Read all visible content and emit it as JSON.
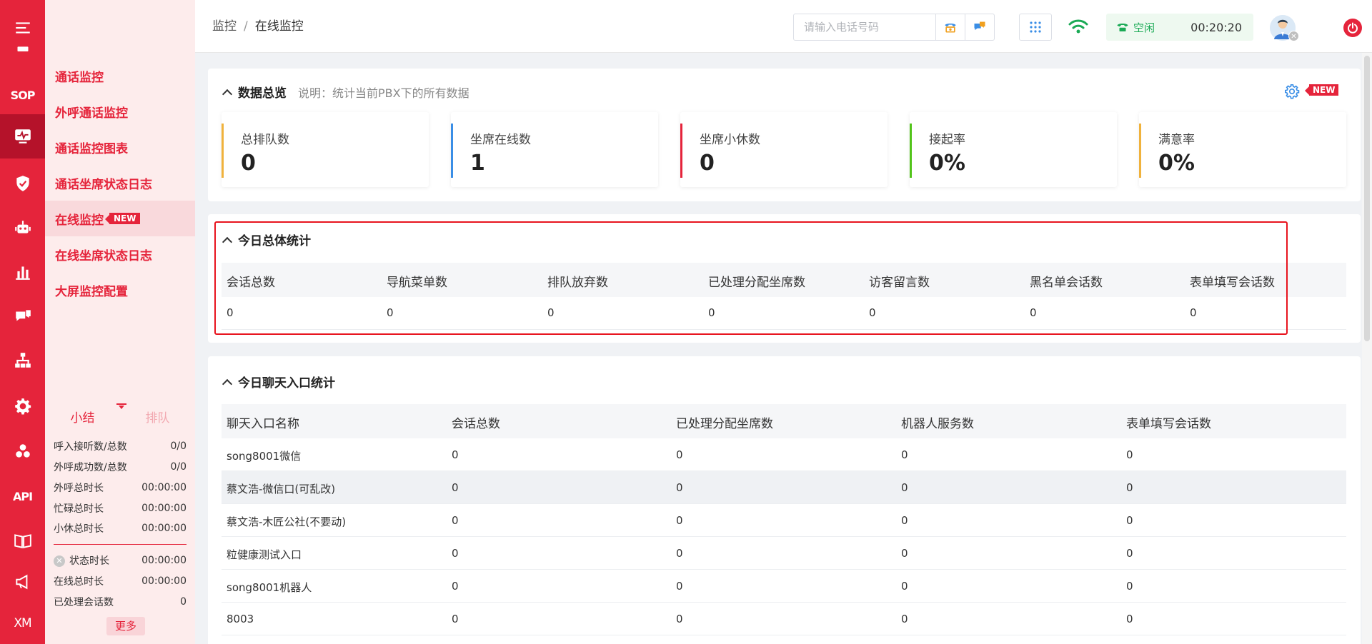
{
  "rail": {
    "items": [
      {
        "name": "menu-icon"
      },
      {
        "name": "card-icon"
      },
      {
        "name": "sop-icon",
        "text": "SOP"
      },
      {
        "name": "monitor-icon",
        "active": true
      },
      {
        "name": "shield-icon"
      },
      {
        "name": "robot-icon"
      },
      {
        "name": "chart-icon"
      },
      {
        "name": "chat-icon"
      },
      {
        "name": "org-icon"
      },
      {
        "name": "gear-icon"
      },
      {
        "name": "modules-icon"
      },
      {
        "name": "api-icon",
        "text": "API"
      },
      {
        "name": "book-icon"
      },
      {
        "name": "megaphone-icon"
      },
      {
        "name": "xm-icon",
        "text": "XM"
      }
    ]
  },
  "submenu": {
    "items": [
      {
        "label": "通话监控"
      },
      {
        "label": "外呼通话监控"
      },
      {
        "label": "通话监控图表"
      },
      {
        "label": "通话坐席状态日志"
      },
      {
        "label": "在线监控",
        "badge": "NEW",
        "active": true
      },
      {
        "label": "在线坐席状态日志"
      },
      {
        "label": "大屏监控配置"
      }
    ]
  },
  "side_stats": {
    "tabs": {
      "summary": "小结",
      "queue": "排队"
    },
    "rows": [
      {
        "label": "呼入接听数/总数",
        "value": "0/0"
      },
      {
        "label": "外呼成功数/总数",
        "value": "0/0"
      },
      {
        "label": "外呼总时长",
        "value": "00:00:00"
      },
      {
        "label": "忙碌总时长",
        "value": "00:00:00"
      },
      {
        "label": "小休总时长",
        "value": "00:00:00"
      }
    ],
    "rows2": [
      {
        "label": "状态时长",
        "value": "00:00:00"
      },
      {
        "label": "在线总时长",
        "value": "00:00:00"
      },
      {
        "label": "已处理会话数",
        "value": "0"
      }
    ],
    "more": "更多"
  },
  "header": {
    "breadcrumb": {
      "parent": "监控",
      "sep": "/",
      "current": "在线监控"
    },
    "phone_placeholder": "请输入电话号码",
    "status": {
      "label": "空闲",
      "timer": "00:20:20"
    }
  },
  "overview": {
    "title": "数据总览",
    "desc": "说明：统计当前PBX下的所有数据",
    "new_tag": "NEW",
    "kpis": [
      {
        "label": "总排队数",
        "value": "0",
        "color": "#f0b23c"
      },
      {
        "label": "坐席在线数",
        "value": "1",
        "color": "#3a8ee6"
      },
      {
        "label": "坐席小休数",
        "value": "0",
        "color": "#e5243b"
      },
      {
        "label": "接起率",
        "value": "0%",
        "color": "#52c41a"
      },
      {
        "label": "满意率",
        "value": "0%",
        "color": "#f0b23c"
      }
    ]
  },
  "today_total": {
    "title": "今日总体统计",
    "columns": [
      "会话总数",
      "导航菜单数",
      "排队放弃数",
      "已处理分配坐席数",
      "访客留言数",
      "黑名单会话数",
      "表单填写会话数"
    ],
    "values": [
      "0",
      "0",
      "0",
      "0",
      "0",
      "0",
      "0"
    ]
  },
  "entry_stats": {
    "title": "今日聊天入口统计",
    "columns": [
      "聊天入口名称",
      "会话总数",
      "已处理分配坐席数",
      "机器人服务数",
      "表单填写会话数"
    ],
    "rows": [
      [
        "song8001微信",
        "0",
        "0",
        "0",
        "0"
      ],
      [
        "蔡文浩-微信口(可乱改)",
        "0",
        "0",
        "0",
        "0"
      ],
      [
        "蔡文浩-木匠公社(不要动)",
        "0",
        "0",
        "0",
        "0"
      ],
      [
        "粒健康测试入口",
        "0",
        "0",
        "0",
        "0"
      ],
      [
        "song8001机器人",
        "0",
        "0",
        "0",
        "0"
      ],
      [
        "8003",
        "0",
        "0",
        "0",
        "0"
      ]
    ]
  }
}
